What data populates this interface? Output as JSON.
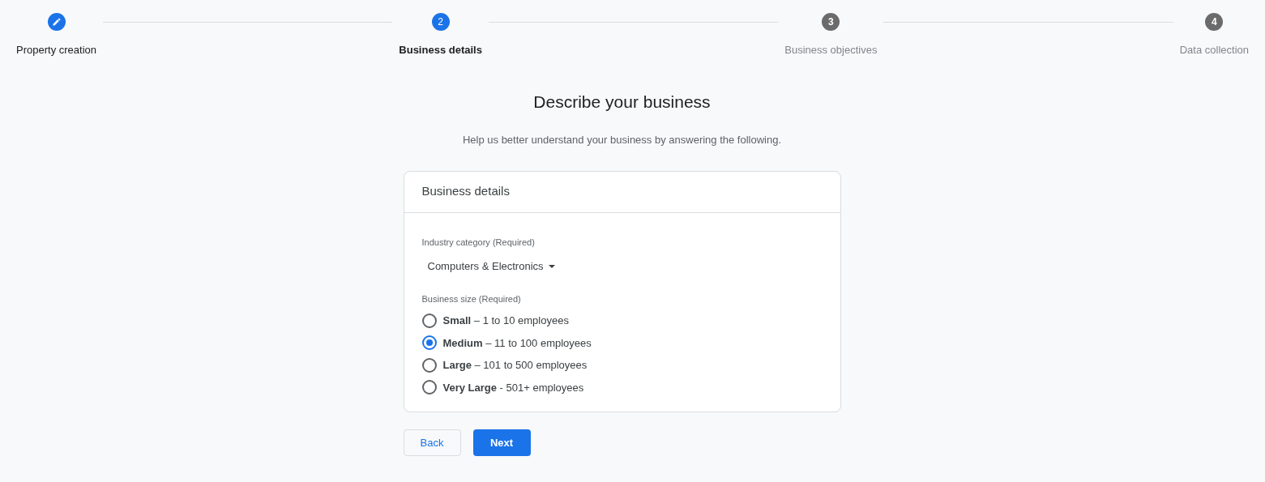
{
  "steps": [
    {
      "label": "Property creation",
      "kind": "done"
    },
    {
      "label": "Business details",
      "kind": "current",
      "number": "2"
    },
    {
      "label": "Business objectives",
      "kind": "upcoming",
      "number": "3"
    },
    {
      "label": "Data collection",
      "kind": "upcoming",
      "number": "4"
    }
  ],
  "heading": "Describe your business",
  "subheading": "Help us better understand your business by answering the following.",
  "card": {
    "title": "Business details",
    "industry": {
      "label": "Industry category (Required)",
      "value": "Computers & Electronics"
    },
    "size": {
      "label": "Business size (Required)",
      "options": [
        {
          "label": "**Small** – 1 to 10 employees",
          "selected": false
        },
        {
          "label": "**Medium** – 11 to 100 employees",
          "selected": true
        },
        {
          "label": "**Large** – 101 to 500 employees",
          "selected": false
        },
        {
          "label": "**Very Large** - 501+ employees",
          "selected": false
        }
      ]
    }
  },
  "buttons": [
    {
      "label": "Back",
      "kind": "secondary"
    },
    {
      "label": "Next",
      "kind": "primary"
    }
  ]
}
